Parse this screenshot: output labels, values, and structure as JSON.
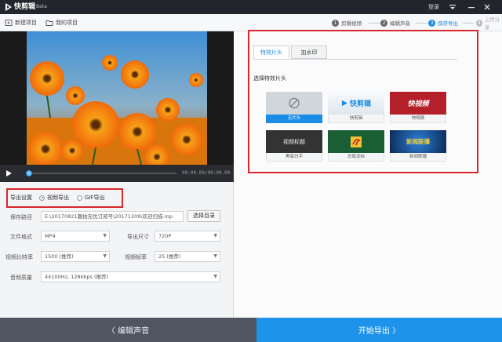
{
  "titlebar": {
    "app_name": "快剪辑",
    "badge": "Beta",
    "login": "登录"
  },
  "toolbar": {
    "new_project": "新建项目",
    "my_projects": "我的项目"
  },
  "steps": [
    {
      "num": "1",
      "label": "剪辑视频",
      "state": "done"
    },
    {
      "num": "2",
      "label": "编辑声音",
      "state": "done"
    },
    {
      "num": "3",
      "label": "保存导出",
      "state": "active"
    },
    {
      "num": "4",
      "label": "上传分享",
      "state": "disabled"
    }
  ],
  "player": {
    "timecode": "00:00.00/00:00.00",
    "progress": 0.02
  },
  "export": {
    "settings_label": "导出设置",
    "options": [
      {
        "label": "视频导出",
        "selected": true
      },
      {
        "label": "GIF导出",
        "selected": false
      }
    ],
    "save_path_label": "保存路径",
    "save_path_value": "E:\\20170821趣拍无忧订阅号\\20171209\\欢迎扫描.mp",
    "browse_label": "选择目录",
    "format_label": "文件格式",
    "format_value": "MP4",
    "size_label": "导出尺寸",
    "size_value": "720P",
    "bitrate_label": "视频比特率",
    "bitrate_value": "1500 (推荐)",
    "framerate_label": "视频帧率",
    "framerate_value": "25 (推荐)",
    "audio_label": "音频质量",
    "audio_value": "44100Hz, 128kbps (推荐)"
  },
  "effects": {
    "tabs": [
      {
        "label": "特效片头",
        "active": true
      },
      {
        "label": "加水印",
        "active": false
      }
    ],
    "section_title": "选择特效片头",
    "thumbnails": [
      {
        "caption": "无片头",
        "overlay": "",
        "selected": true
      },
      {
        "caption": "快剪辑",
        "overlay": "快剪辑",
        "selected": false
      },
      {
        "caption": "快视频",
        "overlay": "快视频",
        "selected": false
      },
      {
        "caption": "黑底白字",
        "overlay": "视频标题",
        "selected": false
      },
      {
        "caption": "总局龙标",
        "overlay": "",
        "selected": false
      },
      {
        "caption": "新闻联播",
        "overlay": "新闻联播",
        "selected": false
      }
    ]
  },
  "footer": {
    "back_label": "〈 编辑声音",
    "export_label": "开始导出 〉"
  },
  "colors": {
    "accent": "#1a8ce6",
    "highlight": "#d9272b",
    "titlebar": "#23252c"
  }
}
